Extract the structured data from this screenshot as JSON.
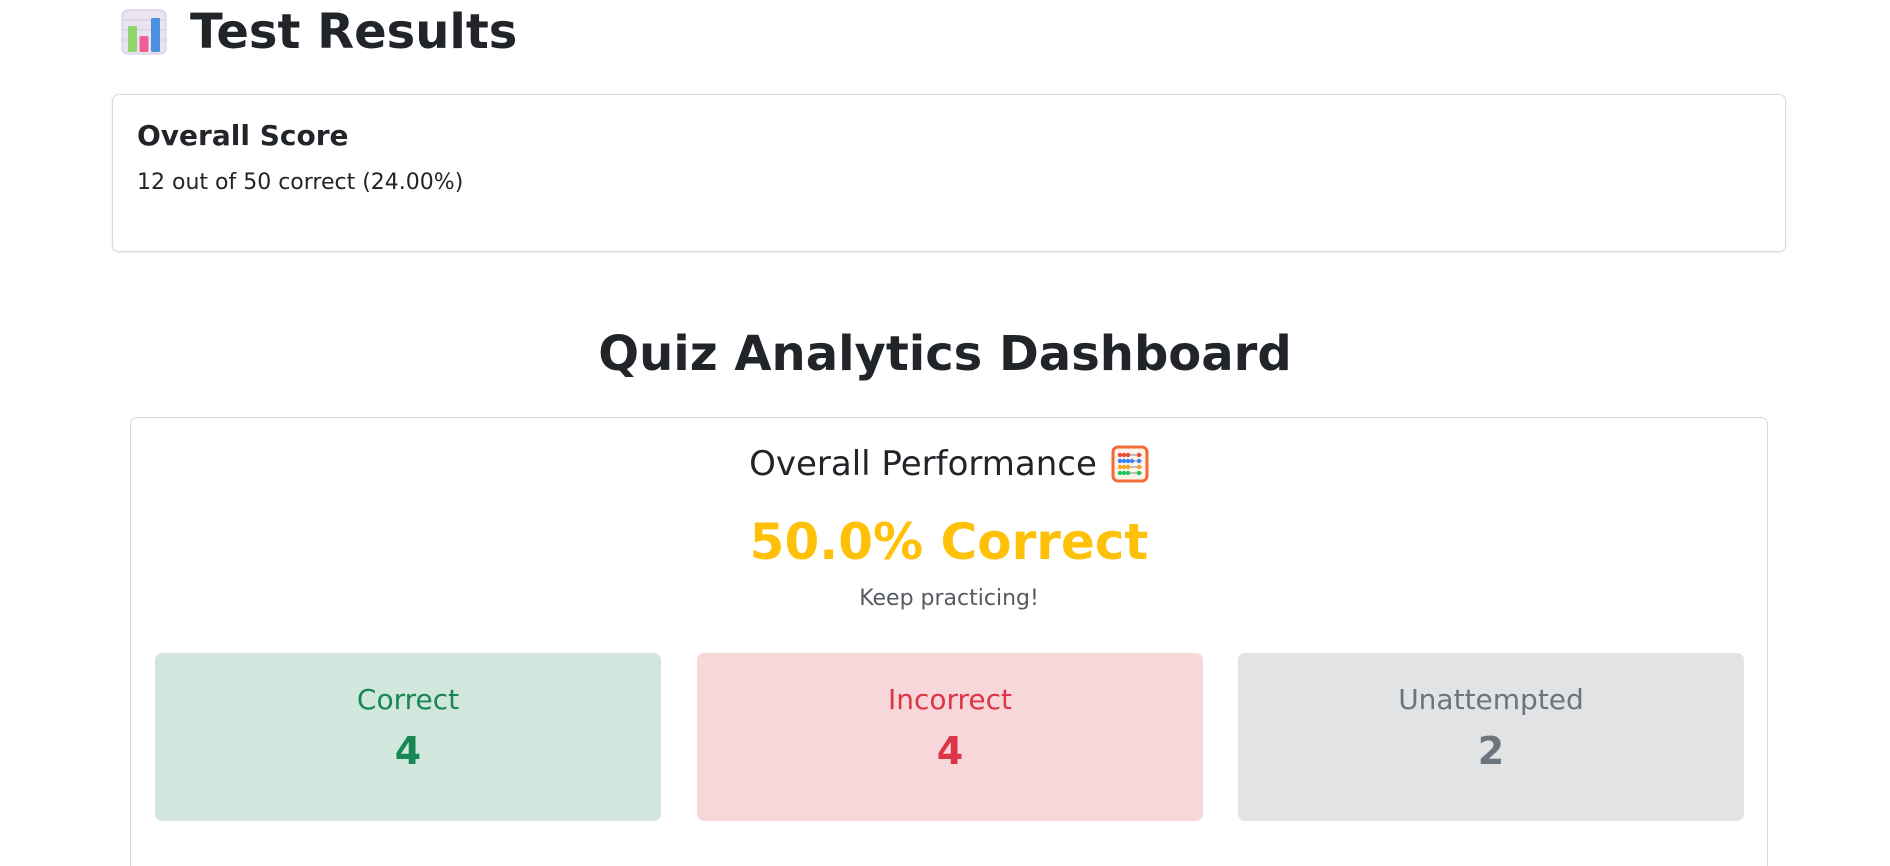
{
  "header": {
    "icon": "bar-chart-emoji",
    "title": "Test Results"
  },
  "overall_score": {
    "heading": "Overall Score",
    "summary": "12 out of 50 correct (24.00%)",
    "correct": 12,
    "total": 50,
    "percent": 24.0
  },
  "dashboard": {
    "title": "Quiz Analytics Dashboard",
    "performance": {
      "heading": "Overall Performance",
      "icon": "abacus-emoji",
      "percent_text": "50.0% Correct",
      "message": "Keep practicing!",
      "accent_color": "#ffc107"
    },
    "stats": [
      {
        "label": "Correct",
        "value": "4",
        "color": "#198754",
        "bg": "#d1e7dd"
      },
      {
        "label": "Incorrect",
        "value": "4",
        "color": "#dc3545",
        "bg": "#f8d7da"
      },
      {
        "label": "Unattempted",
        "value": "2",
        "color": "#6c757d",
        "bg": "#e2e3e5"
      }
    ]
  }
}
